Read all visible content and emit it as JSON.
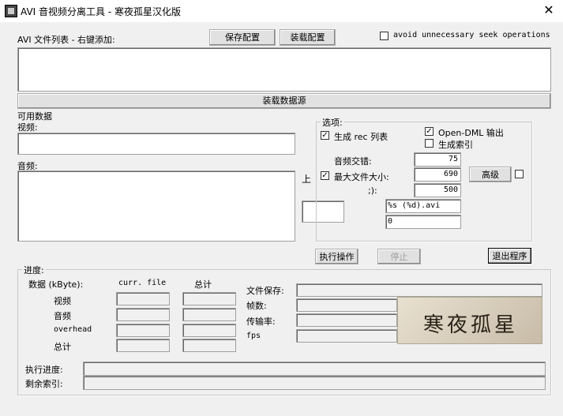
{
  "window": {
    "title": "AVI 音视频分离工具 - 寒夜孤星汉化版",
    "close_symbol": "✕"
  },
  "top": {
    "file_list_label": "AVI 文件列表 - 右键添加:",
    "save_config": "保存配置",
    "load_config": "装载配置",
    "avoid_seek_label": "avoid unnecessary seek operations",
    "load_source": "装载数据源"
  },
  "streams": {
    "available_label": "可用数据",
    "video_label": "视频:",
    "audio_label": "音频:",
    "up_button": "上"
  },
  "options": {
    "title": "选项:",
    "gen_rec_label": "生成 rec 列表",
    "gen_rec_checked": true,
    "opendml_label": "Open-DML 输出",
    "opendml_checked": true,
    "gen_index_label": "生成索引",
    "gen_index_checked": false,
    "audio_interleave_label": "音频交错:",
    "audio_interleave_value": "75",
    "max_size_label": "最大文件大小:",
    "max_size_checked": true,
    "max_size_value": "690",
    "third_label": ";):",
    "third_value": "500",
    "advanced_button": "高级",
    "advanced_checked": false,
    "format_value": "%s (%d).avi",
    "zero_value": "0"
  },
  "actions": {
    "execute": "执行操作",
    "stop": "停止",
    "exit": "退出程序"
  },
  "progress": {
    "title": "进度:",
    "data_label": "数据 (kByte):",
    "curr_file_label": "curr. file",
    "total_label": "总计",
    "rows": [
      "视频",
      "音频",
      "overhead",
      "总计"
    ],
    "file_save_label": "文件保存:",
    "frames_label": "帧数:",
    "transfer_label": "传输率:",
    "fps_label": "fps",
    "exec_progress_label": "执行进度:",
    "remaining_index_label": "剩余索引:",
    "logo_text": "寒夜孤星"
  }
}
